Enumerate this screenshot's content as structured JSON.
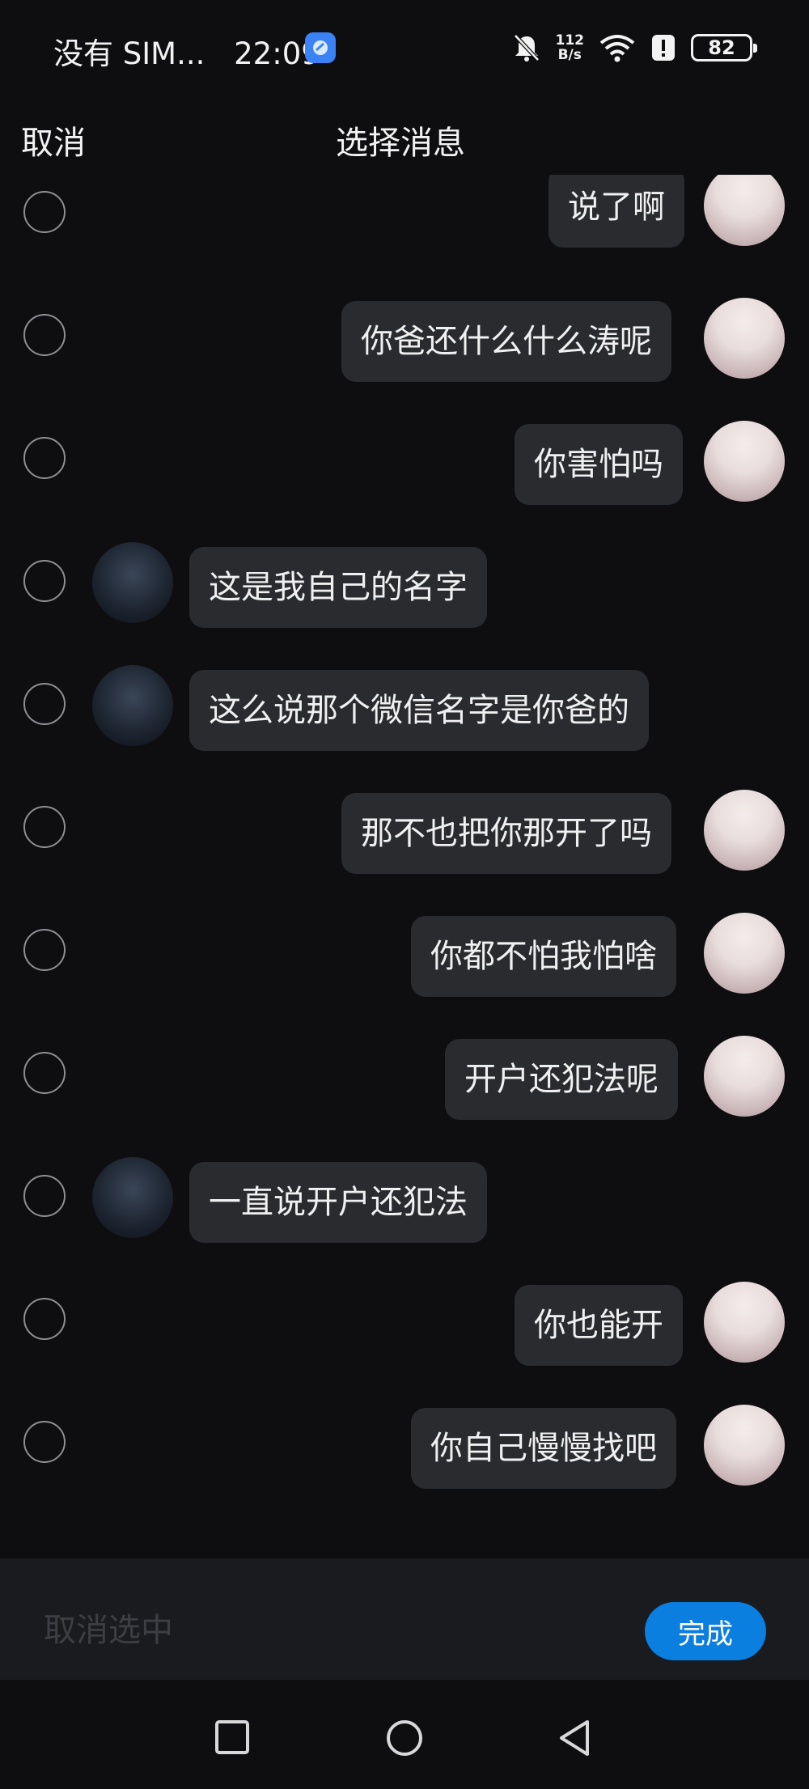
{
  "status_bar": {
    "carrier": "没有 SIM...",
    "time": "22:09",
    "net_speed_value": "112",
    "net_speed_unit": "B/s",
    "battery": "82",
    "icons": [
      "mute-icon",
      "wifi-icon",
      "alert-icon",
      "battery-icon"
    ]
  },
  "header": {
    "cancel_label": "取消",
    "title": "选择消息"
  },
  "messages": [
    {
      "side": "right",
      "text": "说了啊",
      "avatar": "girl-avatar"
    },
    {
      "side": "right",
      "text": "你爸还什么什么涛呢",
      "avatar": "girl-avatar"
    },
    {
      "side": "right",
      "text": "你害怕吗",
      "avatar": "girl-avatar"
    },
    {
      "side": "left",
      "text": "这是我自己的名字",
      "avatar": "boy-avatar"
    },
    {
      "side": "left",
      "text": "这么说那个微信名字是你爸的",
      "avatar": "boy-avatar"
    },
    {
      "side": "right",
      "text": "那不也把你那开了吗",
      "avatar": "girl-avatar"
    },
    {
      "side": "right",
      "text": "你都不怕我怕啥",
      "avatar": "girl-avatar"
    },
    {
      "side": "right",
      "text": "开户还犯法呢",
      "avatar": "girl-avatar"
    },
    {
      "side": "left",
      "text": "一直说开户还犯法",
      "avatar": "boy-avatar"
    },
    {
      "side": "right",
      "text": "你也能开",
      "avatar": "girl-avatar"
    },
    {
      "side": "right",
      "text": "你自己慢慢找吧",
      "avatar": "girl-avatar"
    }
  ],
  "bottom_bar": {
    "deselect_label": "取消选中",
    "done_label": "完成",
    "done_color": "#0a7fe0"
  },
  "nav": {
    "items": [
      "recents-square-icon",
      "home-circle-icon",
      "back-triangle-icon"
    ]
  }
}
